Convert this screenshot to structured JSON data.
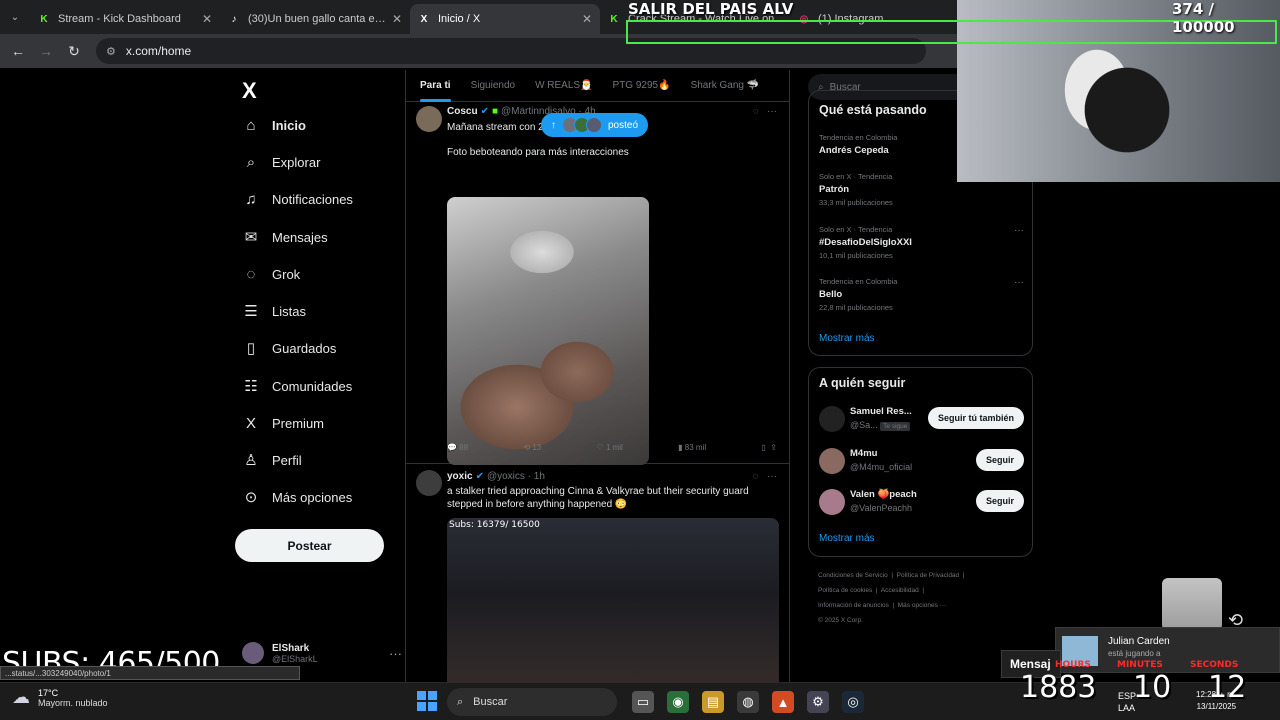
{
  "browser": {
    "tabs": [
      {
        "label": "Stream - Kick Dashboard",
        "icon": "kick-icon",
        "color": "#53fc18"
      },
      {
        "label": "(30)Un buen gallo canta en cua",
        "icon": "tiktok-icon",
        "color": "#ffffff"
      },
      {
        "label": "Inicio / X",
        "icon": "x-icon",
        "color": "#ffffff"
      },
      {
        "label": "Crack Stream - Watch Live on",
        "icon": "kick-icon",
        "color": "#53fc18"
      },
      {
        "label": "(1) Instagram",
        "icon": "instagram-icon",
        "color": "#e1306c"
      }
    ],
    "url": "x.com/home"
  },
  "x": {
    "logo": "X",
    "nav": [
      {
        "label": "Inicio",
        "icon": "home-icon",
        "glyph": "⌂"
      },
      {
        "label": "Explorar",
        "icon": "search-icon",
        "glyph": "⌕"
      },
      {
        "label": "Notificaciones",
        "icon": "bell-icon",
        "glyph": "🔔"
      },
      {
        "label": "Mensajes",
        "icon": "mail-icon",
        "glyph": "✉"
      },
      {
        "label": "Grok",
        "icon": "grok-icon",
        "glyph": "◌"
      },
      {
        "label": "Listas",
        "icon": "list-icon",
        "glyph": "☰"
      },
      {
        "label": "Guardados",
        "icon": "bookmark-icon",
        "glyph": "🔖"
      },
      {
        "label": "Comunidades",
        "icon": "people-icon",
        "glyph": "👥"
      },
      {
        "label": "Premium",
        "icon": "x-premium-icon",
        "glyph": "X"
      },
      {
        "label": "Perfil",
        "icon": "person-icon",
        "glyph": "👤"
      },
      {
        "label": "Más opciones",
        "icon": "more-circle-icon",
        "glyph": "⋯"
      }
    ],
    "post_button": "Postear",
    "account": {
      "name": "ElShark",
      "handle": "@ElSharkL"
    },
    "timeline_tabs": [
      "Para ti",
      "Siguiendo",
      "W REALS🎅",
      "PTG 9295🔥",
      "Shark Gang 🦈"
    ],
    "posted_pill": "posteó",
    "tweets": [
      {
        "name": "Coscu",
        "handle": "@Martinndisalvo · 4h",
        "text1": "Mañana stream con 2",
        "text2": "Foto beboteando para más interacciones",
        "replies": "88",
        "reposts": "13",
        "likes": "1 mil",
        "views": "83 mil"
      },
      {
        "name": "yoxic",
        "handle": "@yoxics · 1h",
        "text1": "a stalker tried approaching Cinna & Valkyrae but their security guard stepped in before anything happened 😳",
        "media_text": "Subs: 16379/ 16500"
      }
    ],
    "right": {
      "search_placeholder": "Buscar",
      "trending_title": "Qué está pasando",
      "trends": [
        {
          "ctx": "Tendencia en Colombia",
          "title": "Andrés Cepeda",
          "count": ""
        },
        {
          "ctx": "Solo en X · Tendencia",
          "title": "Patrón",
          "count": "33,3 mil publicaciones"
        },
        {
          "ctx": "Solo en X · Tendencia",
          "title": "#DesafioDelSigloXXI",
          "count": "10,1 mil publicaciones"
        },
        {
          "ctx": "Tendencia en Colombia",
          "title": "Bello",
          "count": "22,8 mil publicaciones"
        }
      ],
      "show_more": "Mostrar más",
      "who_title": "A quién seguir",
      "who": [
        {
          "name": "Samuel Res...",
          "handle": "@Sa...",
          "badge": "Te sigue",
          "button": "Seguir tú también"
        },
        {
          "name": "M4mu",
          "handle": "@M4mu_oficial",
          "button": "Seguir"
        },
        {
          "name": "Valen 🍑peach",
          "handle": "@ValenPeachh",
          "button": "Seguir"
        }
      ],
      "footer": [
        "Condiciones de Servicio",
        "Política de Privacidad",
        "Política de cookies",
        "Accesibilidad",
        "Información de anuncios",
        "Más opciones ···",
        "© 2025 X Corp."
      ]
    }
  },
  "overlays": {
    "banner": "SALIR DEL PAIS ALV",
    "counter": "374  / 100000",
    "subs": "SUBS: 465/500",
    "status_url": "...status/...303249040/photo/1",
    "chat_label": "Mensaj",
    "notification": {
      "name": "Julian Carden",
      "sub": "está jugando a"
    },
    "timer": {
      "hours_label": "HOURS",
      "minutes_label": "MINUTES",
      "seconds_label": "SECONDS",
      "hours": "1883",
      "minutes": "10",
      "seconds": "12"
    }
  },
  "taskbar": {
    "weather_temp": "17°C",
    "weather_desc": "Mayorm. nublado",
    "search_label": "Buscar",
    "lang": "ESP",
    "lang2": "LAA",
    "time": "12:28 p. m.",
    "date": "13/11/2025"
  }
}
